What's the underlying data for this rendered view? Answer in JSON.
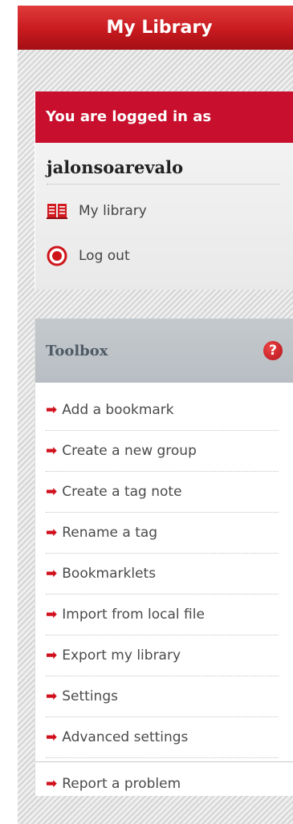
{
  "header": {
    "title": "My Library"
  },
  "login": {
    "heading": "You are logged in as",
    "username": "jalonsoarevalo",
    "links": {
      "my_library": "My library",
      "log_out": "Log out"
    }
  },
  "toolbox": {
    "title": "Toolbox",
    "help_glyph": "?",
    "items": [
      {
        "label": "Add a bookmark",
        "name": "add-bookmark"
      },
      {
        "label": "Create a new group",
        "name": "create-group"
      },
      {
        "label": "Create a tag note",
        "name": "create-tag-note"
      },
      {
        "label": "Rename a tag",
        "name": "rename-tag"
      },
      {
        "label": "Bookmarklets",
        "name": "bookmarklets"
      },
      {
        "label": "Import from local file",
        "name": "import-file"
      },
      {
        "label": "Export my library",
        "name": "export-library"
      },
      {
        "label": "Settings",
        "name": "settings"
      },
      {
        "label": "Advanced settings",
        "name": "advanced-settings"
      }
    ],
    "report": "Report a problem",
    "arrow_glyph": "➡"
  },
  "icons": {
    "book": "book-icon",
    "logout": "power-icon",
    "help": "help-icon",
    "arrow": "arrow-right-icon"
  },
  "colors": {
    "brand_red": "#c8102e",
    "toolbox_head": "#bfc4c8",
    "toolbox_title": "#4e5a64"
  }
}
